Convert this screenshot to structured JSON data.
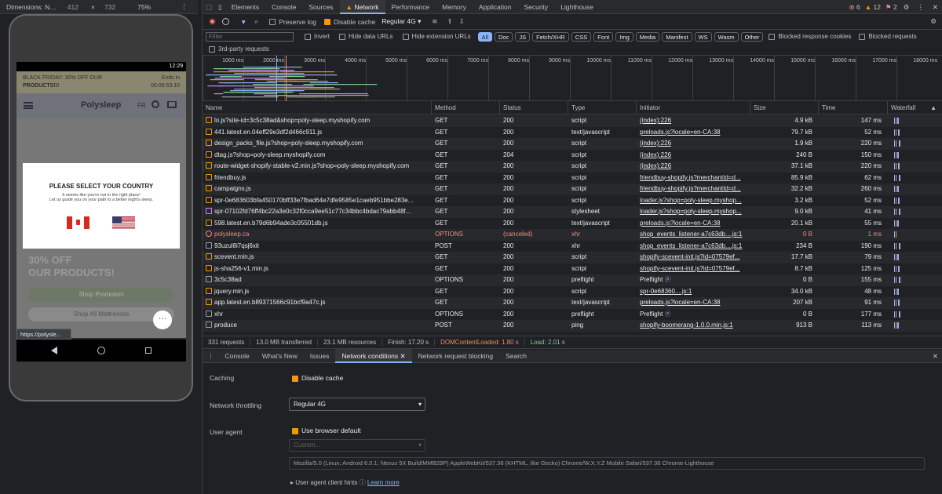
{
  "device_toolbar": {
    "dimensions": "Dimensions: N…",
    "width": "412",
    "x": "×",
    "height": "732",
    "zoom": "75%"
  },
  "phone": {
    "time": "12:29",
    "promo": {
      "line1": "BLACK FRIDAY: 30% OFF OUR",
      "line2": "PRODUCTS!!!",
      "ends": "Ends in",
      "countdown": "00:09:53:10"
    },
    "brand": "Polysleep",
    "lang": "FR",
    "modal": {
      "title": "PLEASE SELECT YOUR COUNTRY",
      "line1": "It seems like you're not in the right place!",
      "line2": "Let us guide you on your path to a better night's sleep."
    },
    "hero_text1": "30% OFF",
    "hero_text2": "OUR PRODUCTS!",
    "btn1": "Shop Promotion",
    "btn2": "Shop All Mattresses",
    "url_tip": "https://polysle..."
  },
  "tabs": [
    "Elements",
    "Console",
    "Sources",
    "Network",
    "Performance",
    "Memory",
    "Application",
    "Security",
    "Lighthouse"
  ],
  "badges": {
    "errors": "6",
    "warnings": "12",
    "issues": "2"
  },
  "netbar": {
    "preserve_log": "Preserve log",
    "disable_cache": "Disable cache",
    "throttle": "Regular 4G"
  },
  "filter": {
    "placeholder": "Filter",
    "invert": "Invert",
    "hide_data": "Hide data URLs",
    "hide_ext": "Hide extension URLs",
    "chips": [
      "All",
      "Doc",
      "JS",
      "Fetch/XHR",
      "CSS",
      "Font",
      "Img",
      "Media",
      "Manifest",
      "WS",
      "Wasm",
      "Other"
    ],
    "blocked_cookies": "Blocked response cookies",
    "blocked_requests": "Blocked requests",
    "third_party": "3rd-party requests"
  },
  "overview_ticks": [
    "1000 ms",
    "2000 ms",
    "3000 ms",
    "4000 ms",
    "5000 ms",
    "6000 ms",
    "7000 ms",
    "8000 ms",
    "9000 ms",
    "10000 ms",
    "11000 ms",
    "12000 ms",
    "13000 ms",
    "14000 ms",
    "15000 ms",
    "16000 ms",
    "17000 ms",
    "18000 ms"
  ],
  "columns": [
    "Name",
    "Method",
    "Status",
    "Type",
    "Initiator",
    "Size",
    "Time",
    "Waterfall"
  ],
  "rows": [
    {
      "name": "lo.js?site-id=3c5c38ad&shop=poly-sleep.myshopify.com",
      "method": "GET",
      "status": "200",
      "type": "script",
      "initiator": "(index):226",
      "size": "4.9 kB",
      "time": "147 ms",
      "icon": "js"
    },
    {
      "name": "441.latest.en.04eff29e3df2d466c911.js",
      "method": "GET",
      "status": "200",
      "type": "text/javascript",
      "initiator": "preloads.js?locale=en-CA:38",
      "size": "79.7 kB",
      "time": "52 ms",
      "icon": "js"
    },
    {
      "name": "design_packs_file.js?shop=poly-sleep.myshopify.com",
      "method": "GET",
      "status": "200",
      "type": "script",
      "initiator": "(index):226",
      "size": "1.9 kB",
      "time": "220 ms",
      "icon": "js"
    },
    {
      "name": "dtag.js?shop=poly-sleep.myshopify.com",
      "method": "GET",
      "status": "204",
      "type": "script",
      "initiator": "(index):226",
      "size": "240 B",
      "time": "150 ms",
      "icon": "js"
    },
    {
      "name": "route-widget-shopify-stable-v2.min.js?shop=poly-sleep.myshopify.com",
      "method": "GET",
      "status": "200",
      "type": "script",
      "initiator": "(index):226",
      "size": "37.1 kB",
      "time": "220 ms",
      "icon": "js"
    },
    {
      "name": "friendbuy.js",
      "method": "GET",
      "status": "200",
      "type": "script",
      "initiator": "friendbuy-shopify.js?merchantId=d...",
      "size": "85.9 kB",
      "time": "62 ms",
      "icon": "js"
    },
    {
      "name": "campaigns.js",
      "method": "GET",
      "status": "200",
      "type": "script",
      "initiator": "friendbuy-shopify.js?merchantId=d...",
      "size": "32.2 kB",
      "time": "260 ms",
      "icon": "js"
    },
    {
      "name": "spr-0e683603bfa450170bff33e7fbad64e7dfe9585e1caeb951bbe283e...",
      "method": "GET",
      "status": "200",
      "type": "script",
      "initiator": "loader.js?shop=poly-sleep.myshop...",
      "size": "3.2 kB",
      "time": "52 ms",
      "icon": "js"
    },
    {
      "name": "spr-07102fd76ff4bc22a3e0c32f0cca9ee51c77c34bbc4bdac79abb48f...",
      "method": "GET",
      "status": "200",
      "type": "stylesheet",
      "initiator": "loader.js?shop=poly-sleep.myshop...",
      "size": "9.0 kB",
      "time": "41 ms",
      "icon": "css"
    },
    {
      "name": "598.latest.en.b79d6b94ade3c05501db.js",
      "method": "GET",
      "status": "200",
      "type": "text/javascript",
      "initiator": "preloads.js?locale=en-CA:38",
      "size": "20.1 kB",
      "time": "55 ms",
      "icon": "js"
    },
    {
      "name": "polysleep.ca",
      "method": "OPTIONS",
      "status": "(canceled)",
      "type": "xhr",
      "initiator": "shop_events_listener-a7c63db....js:1",
      "size": "0 B",
      "time": "1 ms",
      "icon": "err",
      "error": true
    },
    {
      "name": "93uzul8i7qsj6xit",
      "method": "POST",
      "status": "200",
      "type": "xhr",
      "initiator": "shop_events_listener-a7c63db....js:1",
      "size": "234 B",
      "time": "190 ms",
      "icon": "doc"
    },
    {
      "name": "scevent.min.js",
      "method": "GET",
      "status": "200",
      "type": "script",
      "initiator": "shopify-scevent-init.js?id=07579ef...",
      "size": "17.7 kB",
      "time": "79 ms",
      "icon": "js"
    },
    {
      "name": "js-sha256-v1.min.js",
      "method": "GET",
      "status": "200",
      "type": "script",
      "initiator": "shopify-scevent-init.js?id=07579ef...",
      "size": "8.7 kB",
      "time": "125 ms",
      "icon": "js"
    },
    {
      "name": "3c5c38ad",
      "method": "OPTIONS",
      "status": "200",
      "type": "preflight",
      "initiator": "Preflight",
      "size": "0 B",
      "time": "155 ms",
      "icon": "doc",
      "pre": true
    },
    {
      "name": "jquery.min.js",
      "method": "GET",
      "status": "200",
      "type": "script",
      "initiator": "spr-0e68360....js:1",
      "size": "34.0 kB",
      "time": "48 ms",
      "icon": "js"
    },
    {
      "name": "app.latest.en.b89371566c91bcf9a47c.js",
      "method": "GET",
      "status": "200",
      "type": "text/javascript",
      "initiator": "preloads.js?locale=en-CA:38",
      "size": "207 kB",
      "time": "91 ms",
      "icon": "js"
    },
    {
      "name": "xhr",
      "method": "OPTIONS",
      "status": "200",
      "type": "preflight",
      "initiator": "Preflight",
      "size": "0 B",
      "time": "177 ms",
      "icon": "doc",
      "pre": true
    },
    {
      "name": "produce",
      "method": "POST",
      "status": "200",
      "type": "ping",
      "initiator": "shopify-boomerang-1.0.0.min.js:1",
      "size": "913 B",
      "time": "113 ms",
      "icon": "doc"
    }
  ],
  "summary": {
    "requests": "331 requests",
    "transferred": "13.0 MB transferred",
    "resources": "23.1 MB resources",
    "finish": "Finish: 17.20 s",
    "dcl": "DOMContentLoaded: 1.80 s",
    "load": "Load: 2.01 s"
  },
  "drawer_tabs": [
    "Console",
    "What's New",
    "Issues",
    "Network conditions",
    "Network request blocking",
    "Search"
  ],
  "conditions": {
    "caching_label": "Caching",
    "disable_cache": "Disable cache",
    "throttling_label": "Network throttling",
    "throttle_value": "Regular 4G",
    "ua_label": "User agent",
    "use_default": "Use browser default",
    "custom_placeholder": "Custom...",
    "ua_string": "Mozilla/5.0 (Linux; Android 6.0.1; Nexus 5X Build/MMB29P) AppleWebKit/537.36 (KHTML, like Gecko) Chrome/W.X.Y.Z Mobile Safari/537.36 Chrome-Lighthouse",
    "hints": "User agent client hints",
    "learn_more": "Learn more"
  },
  "colors": {
    "accent": "#8ab4f8",
    "error": "#f28b82",
    "warning": "#f29900",
    "dcl": "#f28b60",
    "load": "#81c995"
  }
}
